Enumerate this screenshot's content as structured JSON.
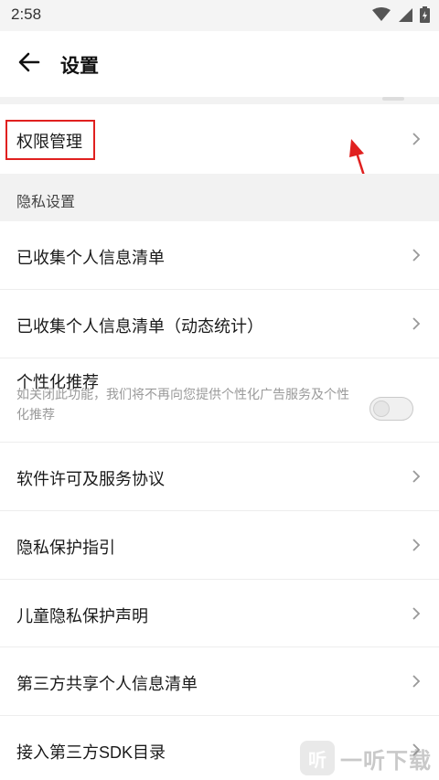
{
  "status_bar": {
    "time": "2:58"
  },
  "header": {
    "title": "设置"
  },
  "items": {
    "permission": "权限管理",
    "privacy_header": "隐私设置",
    "collected_info": "已收集个人信息清单",
    "collected_info_dynamic": "已收集个人信息清单（动态统计）",
    "personalized": {
      "label": "个性化推荐",
      "description": "如关闭此功能，我们将不再向您提供个性化广告服务及个性化推荐",
      "enabled": false
    },
    "license": "软件许可及服务协议",
    "privacy_guide": "隐私保护指引",
    "child_privacy": "儿童隐私保护声明",
    "third_party_share": "第三方共享个人信息清单",
    "third_party_sdk": "接入第三方SDK目录"
  },
  "watermark": {
    "badge": "听",
    "text": "一听下载"
  },
  "colors": {
    "annotation_red": "#e0201f"
  }
}
